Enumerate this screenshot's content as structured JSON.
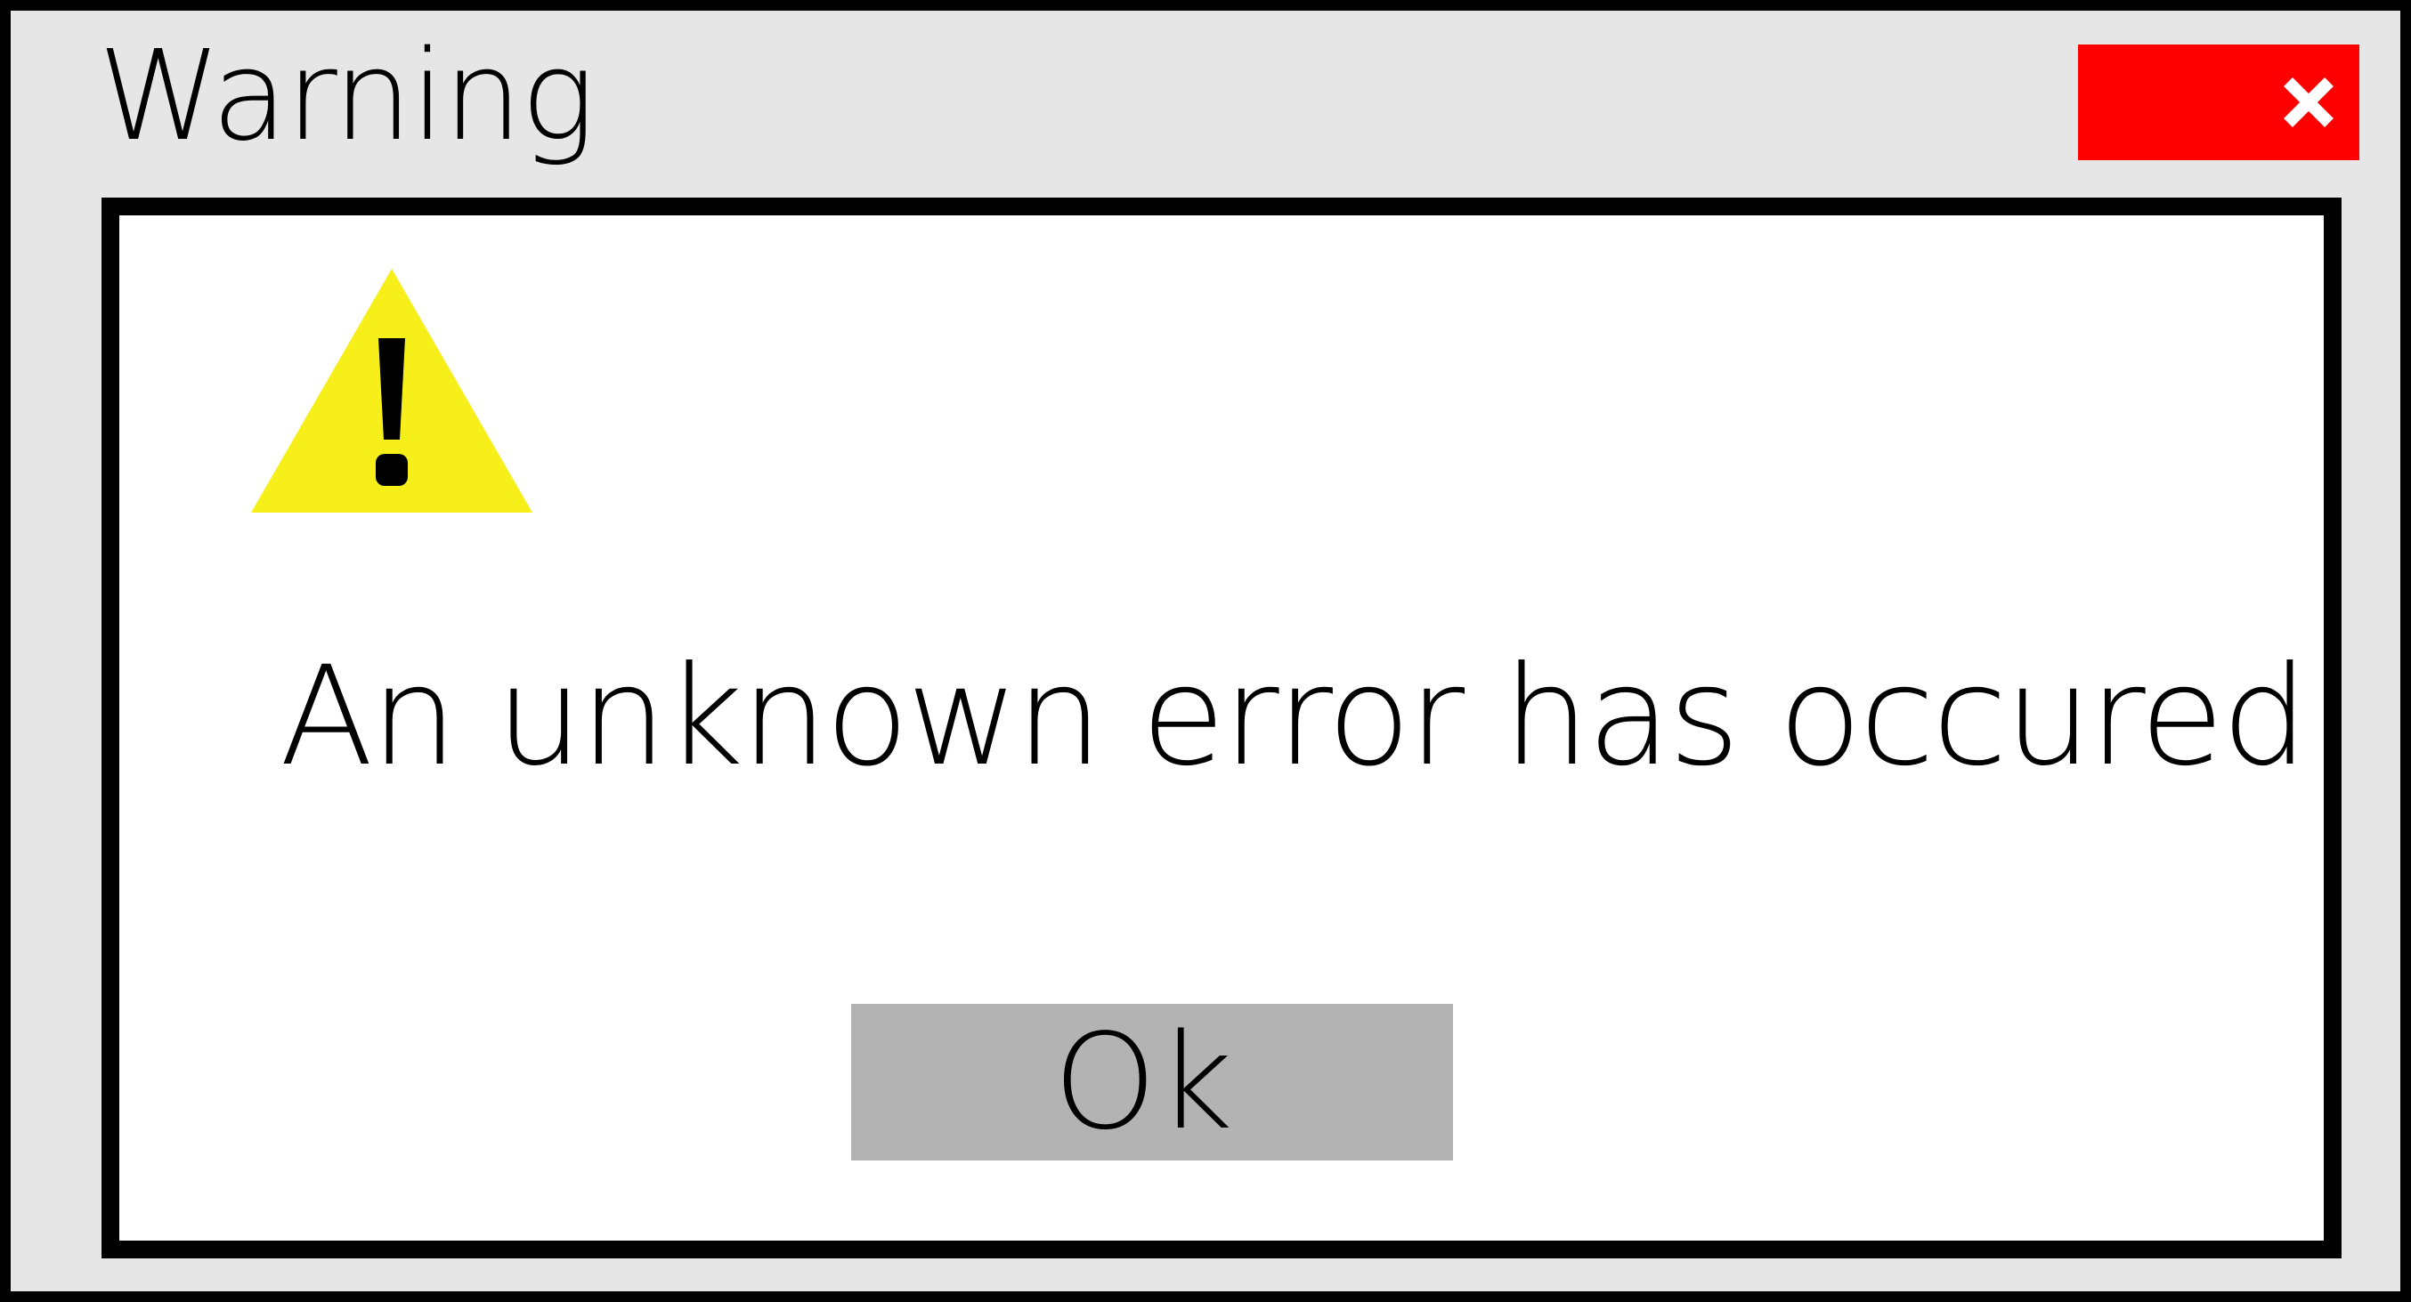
{
  "window": {
    "title": "Warning"
  },
  "close_button": {
    "icon": "close-icon",
    "color": "#ff0000"
  },
  "dialog": {
    "icon": "warning-icon",
    "icon_color": "#f7ef1a",
    "message": "An unknown error has occured",
    "ok_label": "Ok",
    "ok_button_color": "#b3b3b3"
  }
}
